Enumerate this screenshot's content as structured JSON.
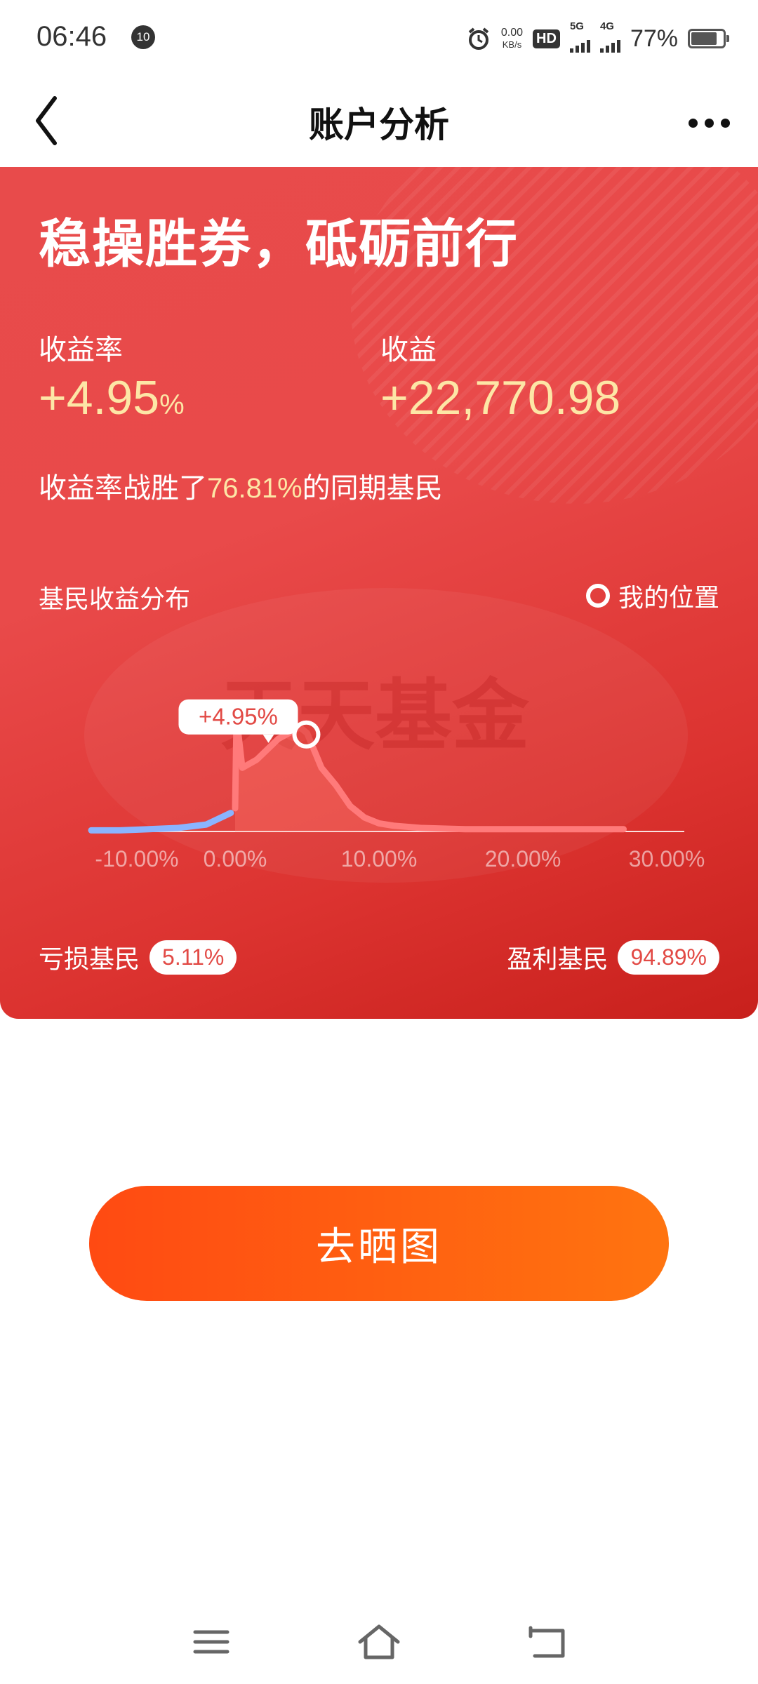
{
  "status_bar": {
    "time": "06:46",
    "notification_badge": "10",
    "net_speed_value": "0.00",
    "net_speed_unit": "KB/s",
    "hd_label": "HD",
    "sim1_label": "5G",
    "sim2_label": "4G",
    "battery_percent": "77%",
    "icons": [
      "alarm-icon",
      "signal-icon",
      "battery-icon"
    ]
  },
  "header": {
    "title": "账户分析",
    "back_icon": "chevron-left-icon",
    "more_icon": "more-dots-icon"
  },
  "card": {
    "slogan": "稳操胜券，砥砺前行",
    "return_rate_label": "收益率",
    "return_rate_value": "+4.95",
    "return_rate_unit": "%",
    "profit_label": "收益",
    "profit_value": "+22,770.98",
    "beat_prefix": "收益率战胜了",
    "beat_percent": "76.81%",
    "beat_suffix": "的同期基民",
    "distribution_title": "基民收益分布",
    "my_position_label": "我的位置",
    "watermark": "天天基金",
    "loss_label": "亏损基民",
    "loss_percent": "5.11%",
    "profit_investors_label": "盈利基民",
    "profit_investors_percent": "94.89%",
    "colors": {
      "loss": "#8ab4ff",
      "profit": "#ff7a7a",
      "highlight": "#fde6a6"
    }
  },
  "chart_data": {
    "type": "area",
    "x_tick_labels": [
      "-10.00%",
      "0.00%",
      "10.00%",
      "20.00%",
      "30.00%"
    ],
    "x_ticks": [
      -10,
      0,
      10,
      20,
      30
    ],
    "xlim": [
      -10,
      30
    ],
    "marker": {
      "x": 4.95,
      "label": "+4.95%"
    },
    "series": [
      {
        "color": "#8ab4ff",
        "points": [
          [
            -10,
            0.01
          ],
          [
            -8,
            0.01
          ],
          [
            -6,
            0.02
          ],
          [
            -4,
            0.03
          ],
          [
            -2,
            0.06
          ],
          [
            -0.3,
            0.16
          ]
        ]
      },
      {
        "color": "#ff7a7a",
        "points": [
          [
            0,
            0.2
          ],
          [
            0.1,
            0.98
          ],
          [
            0.5,
            0.55
          ],
          [
            1.5,
            0.62
          ],
          [
            3,
            0.8
          ],
          [
            4.5,
            0.9
          ],
          [
            5,
            0.85
          ],
          [
            6,
            0.55
          ],
          [
            7,
            0.4
          ],
          [
            8,
            0.22
          ],
          [
            9,
            0.12
          ],
          [
            10,
            0.07
          ],
          [
            11,
            0.05
          ],
          [
            13,
            0.03
          ],
          [
            16,
            0.02
          ],
          [
            20,
            0.02
          ],
          [
            25,
            0.02
          ],
          [
            27,
            0.02
          ]
        ]
      }
    ]
  },
  "share_button": {
    "label": "去晒图"
  },
  "nav_bar": {
    "icons": [
      "menu-icon",
      "home-icon",
      "back-icon"
    ]
  }
}
